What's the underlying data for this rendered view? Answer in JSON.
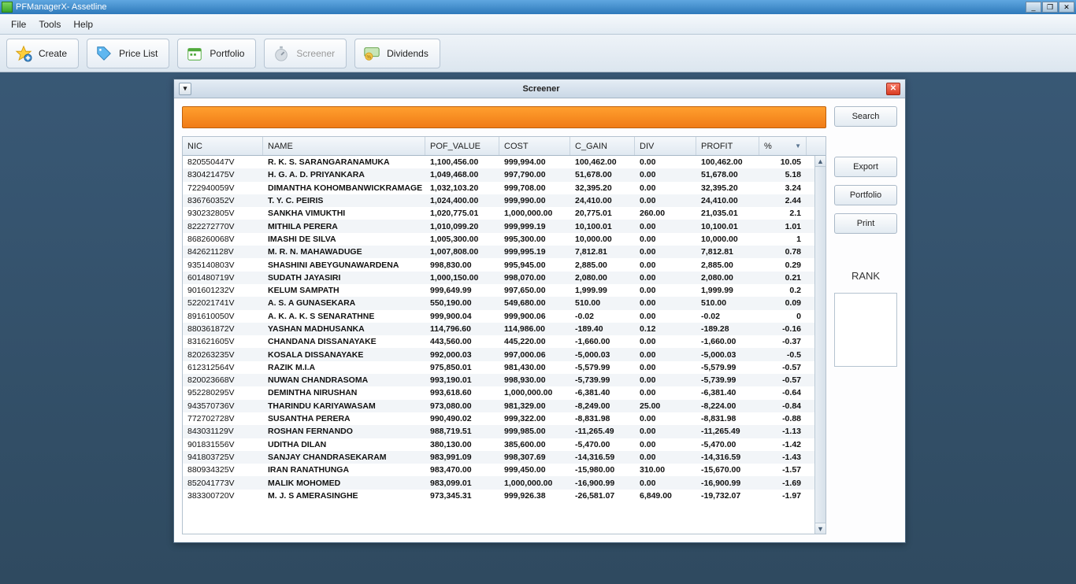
{
  "window": {
    "title": "PFManagerX- Assetline"
  },
  "menubar": {
    "items": [
      "File",
      "Tools",
      "Help"
    ]
  },
  "toolbar": {
    "create": "Create",
    "pricelist": "Price List",
    "portfolio": "Portfolio",
    "screener": "Screener",
    "dividends": "Dividends"
  },
  "dialog": {
    "title": "Screener",
    "search_btn": "Search",
    "export_btn": "Export",
    "portfolio_btn": "Portfolio",
    "print_btn": "Print",
    "rank_label": "RANK"
  },
  "table": {
    "headers": {
      "nic": "NIC",
      "name": "NAME",
      "pof_value": "POF_VALUE",
      "cost": "COST",
      "c_gain": "C_GAIN",
      "div": "DIV",
      "profit": "PROFIT",
      "pct": "%"
    },
    "rows": [
      {
        "nic": "820550447V",
        "name": "R. K. S. SARANGARANAMUKA",
        "pof": "1,100,456.00",
        "cost": "999,994.00",
        "cgain": "100,462.00",
        "div": "0.00",
        "profit": "100,462.00",
        "pct": "10.05"
      },
      {
        "nic": "830421475V",
        "name": "H. G. A. D. PRIYANKARA",
        "pof": "1,049,468.00",
        "cost": "997,790.00",
        "cgain": "51,678.00",
        "div": "0.00",
        "profit": "51,678.00",
        "pct": "5.18"
      },
      {
        "nic": "722940059V",
        "name": "DIMANTHA KOHOMBANWICKRAMAGE",
        "pof": "1,032,103.20",
        "cost": "999,708.00",
        "cgain": "32,395.20",
        "div": "0.00",
        "profit": "32,395.20",
        "pct": "3.24"
      },
      {
        "nic": "836760352V",
        "name": "T. Y. C. PEIRIS",
        "pof": "1,024,400.00",
        "cost": "999,990.00",
        "cgain": "24,410.00",
        "div": "0.00",
        "profit": "24,410.00",
        "pct": "2.44"
      },
      {
        "nic": "930232805V",
        "name": "SANKHA VIMUKTHI",
        "pof": "1,020,775.01",
        "cost": "1,000,000.00",
        "cgain": "20,775.01",
        "div": "260.00",
        "profit": "21,035.01",
        "pct": "2.1"
      },
      {
        "nic": "822272770V",
        "name": "MITHILA PERERA",
        "pof": "1,010,099.20",
        "cost": "999,999.19",
        "cgain": "10,100.01",
        "div": "0.00",
        "profit": "10,100.01",
        "pct": "1.01"
      },
      {
        "nic": "868260068V",
        "name": "IMASHI DE SILVA",
        "pof": "1,005,300.00",
        "cost": "995,300.00",
        "cgain": "10,000.00",
        "div": "0.00",
        "profit": "10,000.00",
        "pct": "1"
      },
      {
        "nic": "842621128V",
        "name": "M. R. N. MAHAWADUGE",
        "pof": "1,007,808.00",
        "cost": "999,995.19",
        "cgain": "7,812.81",
        "div": "0.00",
        "profit": "7,812.81",
        "pct": "0.78"
      },
      {
        "nic": "935140803V",
        "name": "SHASHINI ABEYGUNAWARDENA",
        "pof": "998,830.00",
        "cost": "995,945.00",
        "cgain": "2,885.00",
        "div": "0.00",
        "profit": "2,885.00",
        "pct": "0.29"
      },
      {
        "nic": "601480719V",
        "name": "SUDATH JAYASIRI",
        "pof": "1,000,150.00",
        "cost": "998,070.00",
        "cgain": "2,080.00",
        "div": "0.00",
        "profit": "2,080.00",
        "pct": "0.21"
      },
      {
        "nic": "901601232V",
        "name": "KELUM SAMPATH",
        "pof": "999,649.99",
        "cost": "997,650.00",
        "cgain": "1,999.99",
        "div": "0.00",
        "profit": "1,999.99",
        "pct": "0.2"
      },
      {
        "nic": "522021741V",
        "name": "A. S. A GUNASEKARA",
        "pof": "550,190.00",
        "cost": "549,680.00",
        "cgain": "510.00",
        "div": "0.00",
        "profit": "510.00",
        "pct": "0.09"
      },
      {
        "nic": "891610050V",
        "name": "A. K. A. K. S SENARATHNE",
        "pof": "999,900.04",
        "cost": "999,900.06",
        "cgain": "-0.02",
        "div": "0.00",
        "profit": "-0.02",
        "pct": "0"
      },
      {
        "nic": "880361872V",
        "name": "YASHAN MADHUSANKA",
        "pof": "114,796.60",
        "cost": "114,986.00",
        "cgain": "-189.40",
        "div": "0.12",
        "profit": "-189.28",
        "pct": "-0.16"
      },
      {
        "nic": "831621605V",
        "name": "CHANDANA DISSANAYAKE",
        "pof": "443,560.00",
        "cost": "445,220.00",
        "cgain": "-1,660.00",
        "div": "0.00",
        "profit": "-1,660.00",
        "pct": "-0.37"
      },
      {
        "nic": "820263235V",
        "name": "KOSALA DISSANAYAKE",
        "pof": "992,000.03",
        "cost": "997,000.06",
        "cgain": "-5,000.03",
        "div": "0.00",
        "profit": "-5,000.03",
        "pct": "-0.5"
      },
      {
        "nic": "612312564V",
        "name": "RAZIK M.I.A",
        "pof": "975,850.01",
        "cost": "981,430.00",
        "cgain": "-5,579.99",
        "div": "0.00",
        "profit": "-5,579.99",
        "pct": "-0.57"
      },
      {
        "nic": "820023668V",
        "name": "NUWAN CHANDRASOMA",
        "pof": "993,190.01",
        "cost": "998,930.00",
        "cgain": "-5,739.99",
        "div": "0.00",
        "profit": "-5,739.99",
        "pct": "-0.57"
      },
      {
        "nic": "952280295V",
        "name": "DEMINTHA NIRUSHAN",
        "pof": "993,618.60",
        "cost": "1,000,000.00",
        "cgain": "-6,381.40",
        "div": "0.00",
        "profit": "-6,381.40",
        "pct": "-0.64"
      },
      {
        "nic": "943570736V",
        "name": "THARINDU KARIYAWASAM",
        "pof": "973,080.00",
        "cost": "981,329.00",
        "cgain": "-8,249.00",
        "div": "25.00",
        "profit": "-8,224.00",
        "pct": "-0.84"
      },
      {
        "nic": "772702728V",
        "name": "SUSANTHA PERERA",
        "pof": "990,490.02",
        "cost": "999,322.00",
        "cgain": "-8,831.98",
        "div": "0.00",
        "profit": "-8,831.98",
        "pct": "-0.88"
      },
      {
        "nic": "843031129V",
        "name": "ROSHAN FERNANDO",
        "pof": "988,719.51",
        "cost": "999,985.00",
        "cgain": "-11,265.49",
        "div": "0.00",
        "profit": "-11,265.49",
        "pct": "-1.13"
      },
      {
        "nic": "901831556V",
        "name": "UDITHA DILAN",
        "pof": "380,130.00",
        "cost": "385,600.00",
        "cgain": "-5,470.00",
        "div": "0.00",
        "profit": "-5,470.00",
        "pct": "-1.42"
      },
      {
        "nic": "941803725V",
        "name": "SANJAY CHANDRASEKARAM",
        "pof": "983,991.09",
        "cost": "998,307.69",
        "cgain": "-14,316.59",
        "div": "0.00",
        "profit": "-14,316.59",
        "pct": "-1.43"
      },
      {
        "nic": "880934325V",
        "name": "IRAN RANATHUNGA",
        "pof": "983,470.00",
        "cost": "999,450.00",
        "cgain": "-15,980.00",
        "div": "310.00",
        "profit": "-15,670.00",
        "pct": "-1.57"
      },
      {
        "nic": "852041773V",
        "name": "MALIK MOHOMED",
        "pof": "983,099.01",
        "cost": "1,000,000.00",
        "cgain": "-16,900.99",
        "div": "0.00",
        "profit": "-16,900.99",
        "pct": "-1.69"
      },
      {
        "nic": "383300720V",
        "name": "M. J. S AMERASINGHE",
        "pof": "973,345.31",
        "cost": "999,926.38",
        "cgain": "-26,581.07",
        "div": "6,849.00",
        "profit": "-19,732.07",
        "pct": "-1.97"
      }
    ]
  }
}
